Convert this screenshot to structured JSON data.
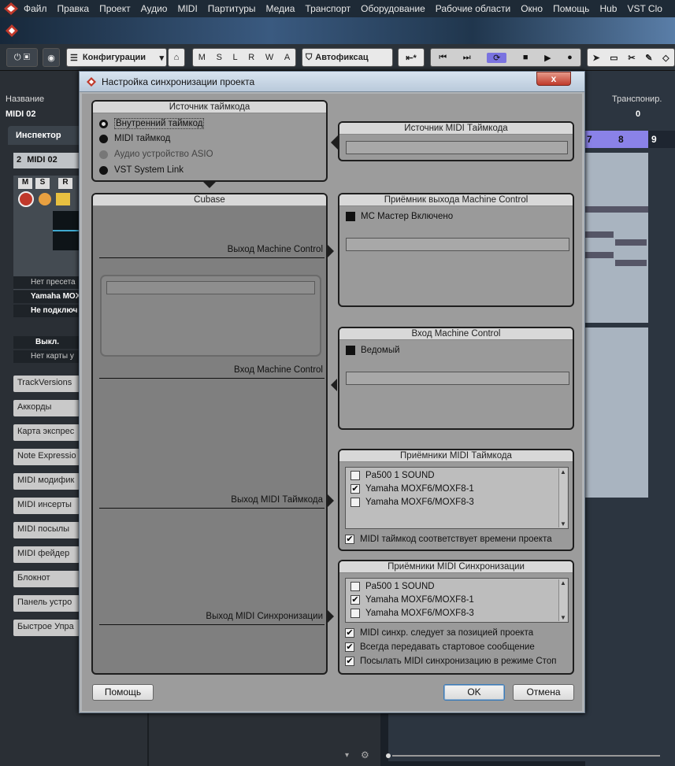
{
  "menubar": [
    "Файл",
    "Правка",
    "Проект",
    "Аудио",
    "MIDI",
    "Партитуры",
    "Медиа",
    "Транспорт",
    "Оборудование",
    "Рабочие области",
    "Окно",
    "Помощь",
    "Hub",
    "VST Clo"
  ],
  "toolbar": {
    "config_label": "Конфигурации",
    "mode_letters": [
      "M",
      "S",
      "L",
      "R",
      "W",
      "A"
    ],
    "autofix_label": "Автофиксац"
  },
  "background": {
    "name_header": "Название",
    "track_name": "MIDI 02",
    "transpose_header": "Транспонир.",
    "transpose_value": "0",
    "ruler": [
      "7",
      "8",
      "9"
    ]
  },
  "inspector": {
    "tab": "Инспектор",
    "track_num": "2",
    "track_name": "MIDI 02",
    "btn_m": "M",
    "btn_s": "S",
    "btn_r": "R",
    "preset": "Нет пресета",
    "device": "Yamaha MOX",
    "not_connected": "Не подключ",
    "off": "Выкл.",
    "no_map": "Нет карты у",
    "sections": [
      "TrackVersions",
      "Аккорды",
      "Карта экспрес",
      "Note Expressio",
      "MIDI модифик",
      "MIDI инсерты",
      "MIDI посылы",
      "MIDI фейдер",
      "Блокнот",
      "Панель устро",
      "Быстрое Упра"
    ]
  },
  "dialog": {
    "title": "Настройка синхронизации проекта",
    "close": "x",
    "timecode_source": {
      "title": "Источник таймкода",
      "options": [
        {
          "label": "Внутренний таймкод",
          "state": "selected"
        },
        {
          "label": "MIDI таймкод",
          "state": "normal"
        },
        {
          "label": "Аудио устройство ASIO",
          "state": "disabled"
        },
        {
          "label": "VST System Link",
          "state": "normal"
        }
      ]
    },
    "midi_tc_source": {
      "title": "Источник MIDI Таймкода",
      "value": ""
    },
    "cubase": {
      "title": "Cubase",
      "mc_out": "Выход Machine Control",
      "mc_in": "Вход Machine Control",
      "midi_tc_out": "Выход MIDI Таймкода",
      "midi_sync_out": "Выход MIDI Синхронизации"
    },
    "mc_out_panel": {
      "title": "Приёмник выхода Machine Control",
      "checkbox": "МС Мастер Включено",
      "value": ""
    },
    "mc_in_panel": {
      "title": "Вход Machine Control",
      "checkbox": "Ведомый",
      "value": ""
    },
    "midi_tc_dest": {
      "title": "Приёмники MIDI Таймкода",
      "items": [
        {
          "label": "Pa500 1 SOUND",
          "checked": false
        },
        {
          "label": "Yamaha MOXF6/MOXF8-1",
          "checked": true
        },
        {
          "label": "Yamaha MOXF6/MOXF8-3",
          "checked": false
        }
      ],
      "option": "MIDI таймкод соответствует времени проекта"
    },
    "midi_sync_dest": {
      "title": "Приёмники MIDI Синхронизации",
      "items": [
        {
          "label": "Pa500 1 SOUND",
          "checked": false
        },
        {
          "label": "Yamaha MOXF6/MOXF8-1",
          "checked": true
        },
        {
          "label": "Yamaha MOXF6/MOXF8-3",
          "checked": false
        }
      ],
      "options": [
        "MIDI синхр. следует за позицией проекта",
        "Всегда передавать стартовое сообщение",
        "Посылать MIDI синхронизацию в режиме Стоп"
      ]
    },
    "help_button": "Помощь",
    "ok_button": "OK",
    "cancel_button": "Отмена"
  },
  "colors": {
    "accent": "#7a73e0",
    "dialog_bg": "#9c9c9c"
  }
}
